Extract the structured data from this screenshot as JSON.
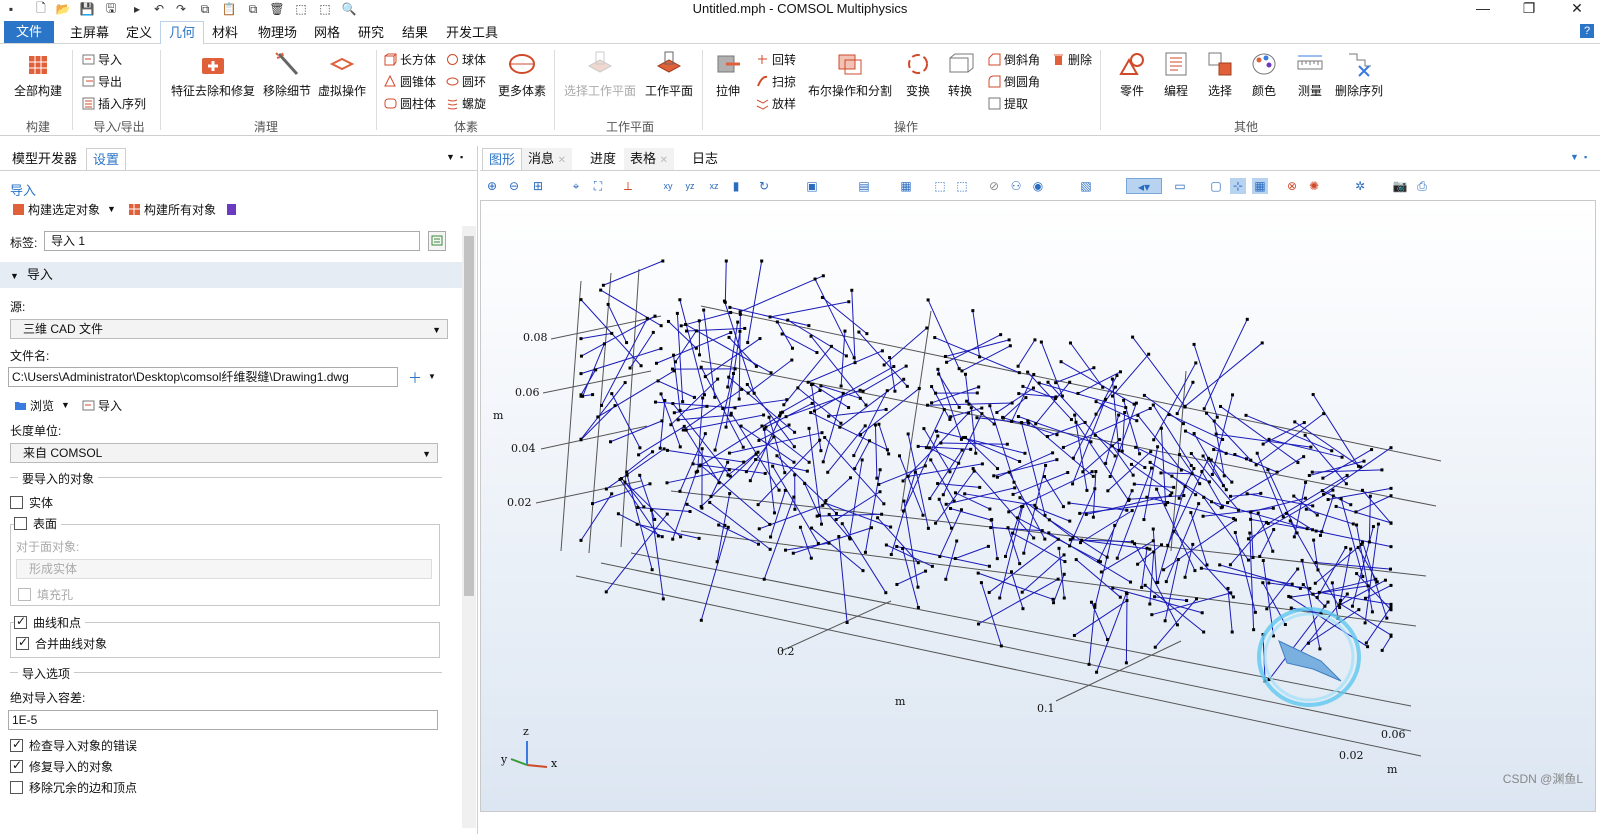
{
  "window": {
    "title": "Untitled.mph - COMSOL Multiphysics"
  },
  "menu": {
    "file": "文件",
    "items": [
      "主屏幕",
      "定义",
      "几何",
      "材料",
      "物理场",
      "网格",
      "研究",
      "结果",
      "开发工具"
    ],
    "help": "?"
  },
  "ribbon": {
    "build_all": "全部构建",
    "import": "导入",
    "export": "导出",
    "insert_sequence": "插入序列",
    "defeature": "特征去除和修复",
    "remove_details": "移除细节",
    "virtual_ops": "虚拟操作",
    "block": "长方体",
    "cone": "圆锥体",
    "cylinder": "圆柱体",
    "sphere": "球体",
    "torus": "圆环",
    "helix": "螺旋",
    "more_primitives": "更多体素",
    "select_workplane": "选择工作平面",
    "workplane": "工作平面",
    "extrude": "拉伸",
    "revolve": "回转",
    "sweep": "扫掠",
    "loft": "放样",
    "booleans": "布尔操作和分割",
    "transforms": "变换",
    "conversions": "转换",
    "chamfer": "倒斜角",
    "fillet": "倒圆角",
    "extract": "提取",
    "delete": "删除",
    "parts": "零件",
    "programming": "编程",
    "selections": "选择",
    "colors": "颜色",
    "measure": "测量",
    "delete_sequence": "删除序列",
    "groups": {
      "build": "构建",
      "import_export": "导入/导出",
      "cleanup": "清理",
      "primitives": "体素",
      "workplane": "工作平面",
      "operations": "操作",
      "other": "其他"
    }
  },
  "left": {
    "tabs": [
      "模型开发器",
      "设置"
    ],
    "node_title": "导入",
    "build_selected": "构建选定对象",
    "build_all_objects": "构建所有对象",
    "label_caption": "标签:",
    "label_value": "导入 1",
    "section": "导入",
    "source_caption": "源:",
    "source_value": "三维 CAD 文件",
    "filename_caption": "文件名:",
    "filename_value": "C:\\Users\\Administrator\\Desktop\\comsol纤维裂缝\\Drawing1.dwg",
    "browse": "浏览",
    "import": "导入",
    "length_unit_caption": "长度单位:",
    "length_unit_value": "来自 COMSOL",
    "objects_title": "要导入的对象",
    "solids": "实体",
    "surfaces": "表面",
    "for_surface_objects": "对于面对象:",
    "form_solids": "形成实体",
    "fill_holes": "填充孔",
    "curves_points": "曲线和点",
    "merge_curves": "合并曲线对象",
    "options_title": "导入选项",
    "tolerance_caption": "绝对导入容差:",
    "tolerance_value": "1E-5",
    "check_errors": "检查导入对象的错误",
    "repair": "修复导入的对象",
    "remove_redundant": "移除冗余的边和顶点"
  },
  "right": {
    "tabs": [
      "图形",
      "消息",
      "进度",
      "表格",
      "日志"
    ]
  },
  "axes": {
    "vertical_ticks": [
      "0.08",
      "0.06",
      "0.04",
      "0.02"
    ],
    "vertical_unit": "m",
    "x_ticks": [
      "0.2",
      "0.1"
    ],
    "x_unit": "m",
    "y_ticks": [
      "0.06",
      "0.02"
    ],
    "y_unit": "m",
    "triad": {
      "z": "z",
      "y": "y",
      "x": "x"
    }
  },
  "watermark": "CSDN @渊鱼L",
  "colors": {
    "accent": "#2a75c8",
    "fiber": "#1a1ab8"
  }
}
